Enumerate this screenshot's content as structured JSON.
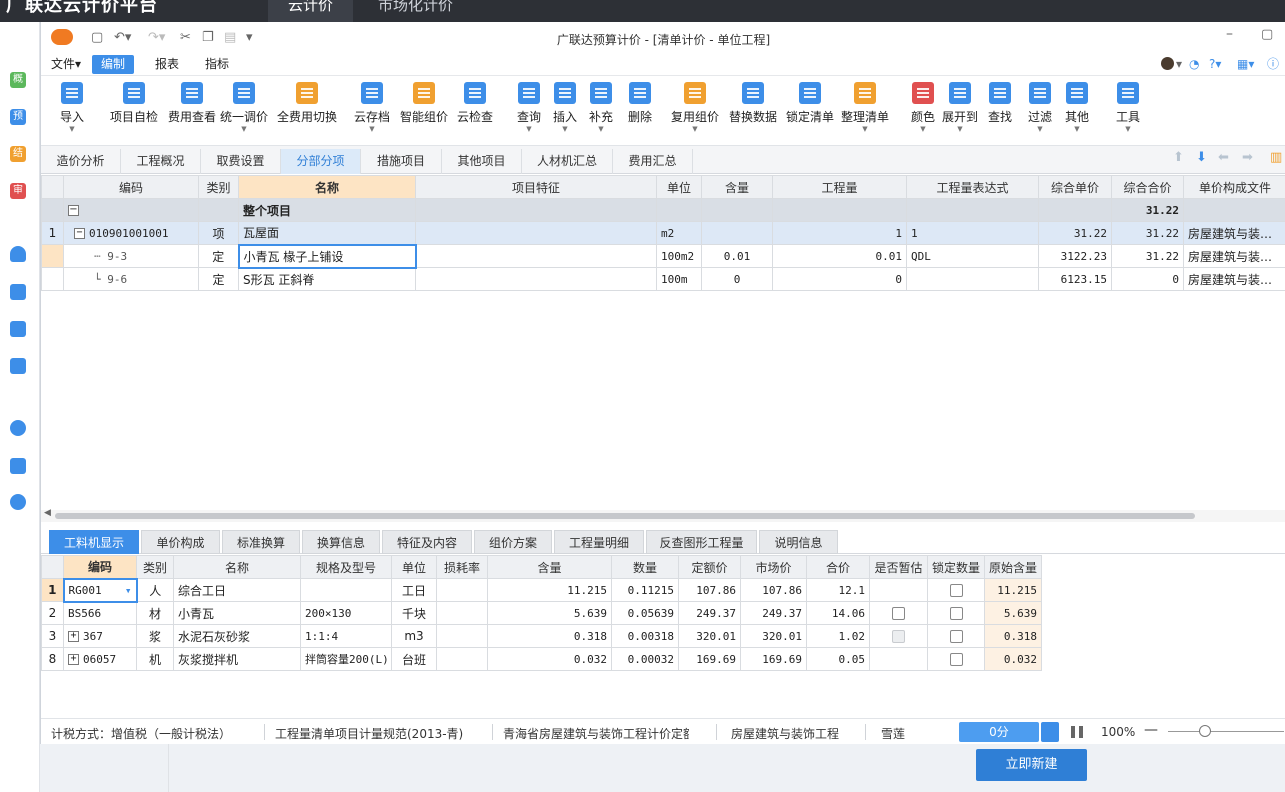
{
  "app": {
    "brand": "广联达云计价平台",
    "tabs": [
      "云计价",
      "市场化计价"
    ]
  },
  "window": {
    "title": "广联达预算计价 - [清单计价 - 单位工程]",
    "min_icon": "minimize-icon",
    "max_icon": "maximize-icon"
  },
  "menu": [
    "文件▾",
    "编制",
    "报表",
    "指标"
  ],
  "leftnav": [
    "概",
    "预",
    "结",
    "审"
  ],
  "ribbon": [
    {
      "label": "导入",
      "icon": "import-icon",
      "color": "#3d8ee8",
      "dd": true
    },
    {
      "label": "项目自检",
      "icon": "check-icon",
      "color": "#3d8ee8"
    },
    {
      "label": "费用查看",
      "icon": "view-fee-icon",
      "color": "#3d8ee8"
    },
    {
      "label": "统一调价",
      "icon": "adjust-price-icon",
      "color": "#3d8ee8",
      "dd": true
    },
    {
      "label": "全费用切换",
      "icon": "switch-icon",
      "color": "#f0a030"
    },
    {
      "label": "云存档",
      "icon": "cloud-save-icon",
      "color": "#3d8ee8",
      "dd": true
    },
    {
      "label": "智能组价",
      "icon": "smart-price-icon",
      "color": "#f0a030"
    },
    {
      "label": "云检查",
      "icon": "cloud-check-icon",
      "color": "#3d8ee8"
    },
    {
      "label": "查询",
      "icon": "query-icon",
      "color": "#3d8ee8",
      "dd": true
    },
    {
      "label": "插入",
      "icon": "insert-icon",
      "color": "#3d8ee8",
      "dd": true
    },
    {
      "label": "补充",
      "icon": "supplement-icon",
      "color": "#3d8ee8",
      "dd": true
    },
    {
      "label": "删除",
      "icon": "delete-icon",
      "color": "#3d8ee8"
    },
    {
      "label": "复用组价",
      "icon": "reuse-icon",
      "color": "#f0a030",
      "dd": true
    },
    {
      "label": "替换数据",
      "icon": "replace-icon",
      "color": "#3d8ee8"
    },
    {
      "label": "锁定清单",
      "icon": "lock-icon",
      "color": "#3d8ee8"
    },
    {
      "label": "整理清单",
      "icon": "organize-icon",
      "color": "#f0a030",
      "dd": true
    },
    {
      "label": "颜色",
      "icon": "color-icon",
      "color": "#e05050",
      "dd": true
    },
    {
      "label": "展开到",
      "icon": "expand-icon",
      "color": "#3d8ee8",
      "dd": true
    },
    {
      "label": "查找",
      "icon": "find-icon",
      "color": "#3d8ee8"
    },
    {
      "label": "过滤",
      "icon": "filter-icon",
      "color": "#3d8ee8",
      "dd": true
    },
    {
      "label": "其他",
      "icon": "other-icon",
      "color": "#3d8ee8",
      "dd": true
    },
    {
      "label": "工具",
      "icon": "tool-icon",
      "color": "#3d8ee8",
      "dd": true
    }
  ],
  "tabs1": [
    "造价分析",
    "工程概况",
    "取费设置",
    "分部分项",
    "措施项目",
    "其他项目",
    "人材机汇总",
    "费用汇总"
  ],
  "grid1": {
    "headers": [
      "编码",
      "类别",
      "名称",
      "项目特征",
      "单位",
      "含量",
      "工程量",
      "工程量表达式",
      "综合单价",
      "综合合价",
      "单价构成文件"
    ],
    "root": {
      "name": "整个项目",
      "total": "31.22"
    },
    "rows": [
      {
        "no": "1",
        "code": "010901001001",
        "type": "项",
        "name": "瓦屋面",
        "feature": "",
        "unit": "m2",
        "content": "",
        "qty": "1",
        "expr": "1",
        "price": "31.22",
        "total": "31.22",
        "file": "房屋建筑与装…"
      },
      {
        "no": "",
        "code": "9-3",
        "type": "定",
        "name": "小青瓦 椽子上铺设",
        "feature": "",
        "unit": "100m2",
        "content": "0.01",
        "qty": "0.01",
        "expr": "QDL",
        "price": "3122.23",
        "total": "31.22",
        "file": "房屋建筑与装…"
      },
      {
        "no": "",
        "code": "9-6",
        "type": "定",
        "name": "S形瓦 正斜脊",
        "feature": "",
        "unit": "100m",
        "content": "0",
        "qty": "0",
        "expr": "",
        "price": "6123.15",
        "total": "0",
        "file": "房屋建筑与装…"
      }
    ]
  },
  "tabs2": [
    "工料机显示",
    "单价构成",
    "标准换算",
    "换算信息",
    "特征及内容",
    "组价方案",
    "工程量明细",
    "反查图形工程量",
    "说明信息"
  ],
  "grid2": {
    "headers": [
      "编码",
      "类别",
      "名称",
      "规格及型号",
      "单位",
      "损耗率",
      "含量",
      "数量",
      "定额价",
      "市场价",
      "合价",
      "是否暂估",
      "锁定数量",
      "原始含量"
    ],
    "rows": [
      {
        "no": "1",
        "code": "RG001",
        "type": "人",
        "name": "综合工日",
        "spec": "",
        "unit": "工日",
        "loss": "",
        "content": "11.215",
        "amount": "0.11215",
        "base": "107.86",
        "market": "107.86",
        "sum": "12.1",
        "est": "none",
        "lock": "box",
        "orig": "11.215"
      },
      {
        "no": "2",
        "code": "BS566",
        "type": "材",
        "name": "小青瓦",
        "spec": "200×130",
        "unit": "千块",
        "loss": "",
        "content": "5.639",
        "amount": "0.05639",
        "base": "249.37",
        "market": "249.37",
        "sum": "14.06",
        "est": "box",
        "lock": "box",
        "orig": "5.639"
      },
      {
        "no": "3",
        "code": "367",
        "type": "浆",
        "name": "水泥石灰砂浆",
        "spec": "1:1:4",
        "unit": "m3",
        "loss": "",
        "content": "0.318",
        "amount": "0.00318",
        "base": "320.01",
        "market": "320.01",
        "sum": "1.02",
        "est": "dis",
        "lock": "box",
        "orig": "0.318"
      },
      {
        "no": "8",
        "code": "06057",
        "type": "机",
        "name": "灰浆搅拌机",
        "spec": "拌筒容量200(L)",
        "unit": "台班",
        "loss": "",
        "content": "0.032",
        "amount": "0.00032",
        "base": "169.69",
        "market": "169.69",
        "sum": "0.05",
        "est": "none",
        "lock": "box",
        "orig": "0.032"
      }
    ]
  },
  "status": {
    "tax": "计税方式：增值税（一般计税法）",
    "spec": "工程量清单项目计量规范(2013-青)",
    "std": "青海省房屋建筑与装饰工程计价定额",
    "type": "房屋建筑与装饰工程",
    "user": "雪莲",
    "score": "0分",
    "zoom": "100%"
  },
  "new_button": "立即新建"
}
